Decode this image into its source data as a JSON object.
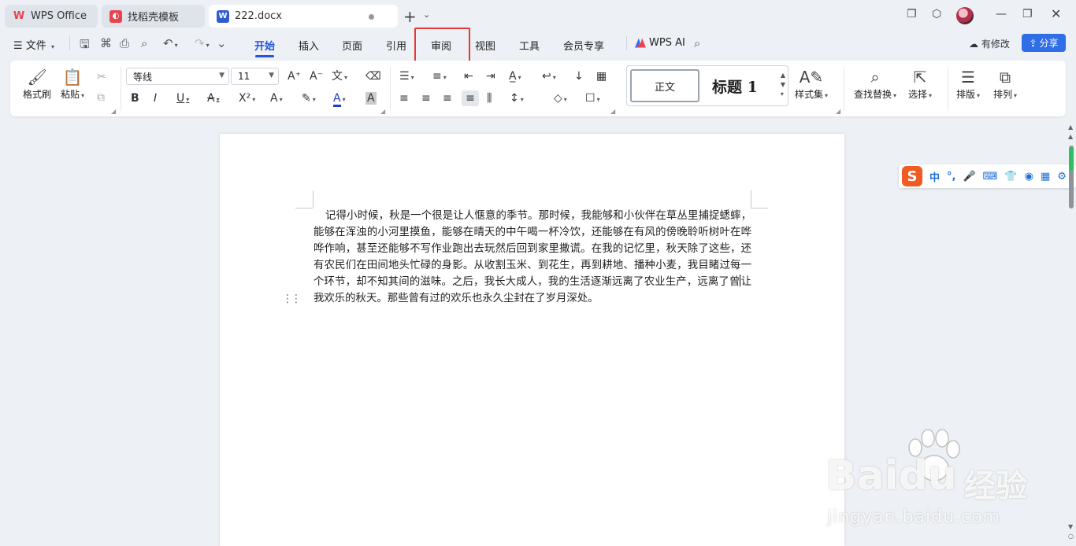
{
  "tabs": [
    {
      "label": "WPS Office",
      "icon": "wps-logo-icon",
      "color": "#e8434f"
    },
    {
      "label": "找稻壳模板",
      "icon": "docer-icon",
      "color": "#e8434f"
    },
    {
      "label": "222.docx",
      "icon": "word-doc-icon",
      "color": "#2f5bd3"
    }
  ],
  "menu": {
    "file": "文件",
    "tabs": [
      "开始",
      "插入",
      "页面",
      "引用",
      "审阅",
      "视图",
      "工具",
      "会员专享"
    ],
    "active_tab": "开始",
    "highlighted_tab": "审阅",
    "ai": "WPS AI",
    "modified": "有修改",
    "share": "分享"
  },
  "ribbon": {
    "format_painter": "格式刷",
    "paste": "粘贴",
    "font_name": "等线",
    "font_size": "11",
    "style_normal": "正文",
    "style_heading": "标题 1",
    "style_set": "样式集",
    "find_replace": "查找替换",
    "select": "选择",
    "layout": "排版",
    "arrange": "排列"
  },
  "document": {
    "before_caret": "记得小时候，秋是一个很是让人惬意的季节。那时候，我能够和小伙伴在草丛里捕捉蟋蟀，能够在浑浊的小河里摸鱼，能够在晴天的中午喝一杯冷饮，还能够在有风的傍晚聆听树叶在哗哗作响，甚至还能够不写作业跑出去玩然后回到家里撒谎。在我的记忆里，秋天除了这些，还有农民们在田间地头忙碌的身影。从收割玉米、到花生，再到耕地、播种小麦，我目睹过每一个环节，却不知其间的滋味。之后，我长大成人，我的生活逐渐远离了农业生产，远离了曾",
    "after_caret": "让我欢乐的秋天。那些曾有过的欢乐也永久尘封在了岁月深处。"
  },
  "ime": {
    "label": "中"
  },
  "watermark": {
    "brand": "Baidu",
    "cn": "经验",
    "url": "jingyan.baidu.com"
  }
}
